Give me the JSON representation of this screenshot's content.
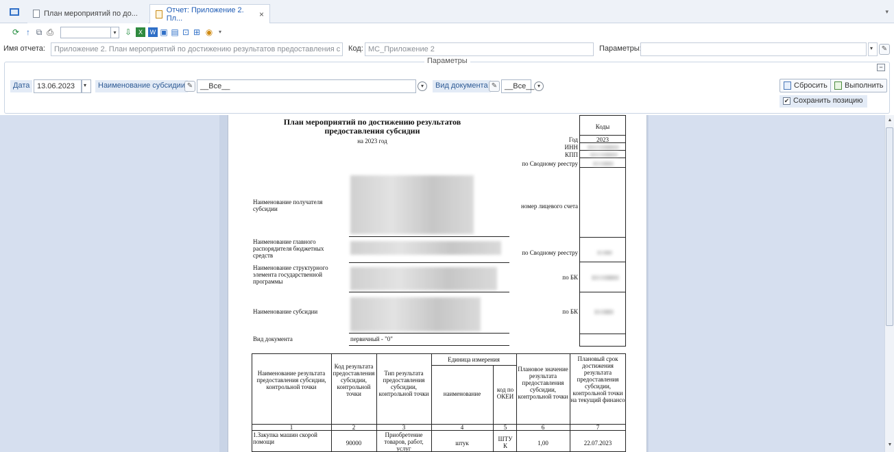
{
  "tabs": [
    {
      "label": "План мероприятий по до..."
    },
    {
      "label": "Отчет: Приложение 2. Пл..."
    }
  ],
  "tab_close": "×",
  "tab_menu_arrow": "▾",
  "name_row": {
    "report_name_label": "Имя отчета:",
    "report_name_value": "Приложение 2. План мероприятий по достижению результатов предоставления с",
    "code_label": "Код:",
    "code_value": "МС_Приложение 2",
    "params_label": "Параметры:",
    "params_value": ""
  },
  "params_panel": {
    "title": "Параметры",
    "date_label": "Дата",
    "date_value": "13.06.2023",
    "subsidy_label": "Наименование субсидии",
    "subsidy_value": "__Все__",
    "doc_type_label": "Вид документа",
    "doc_type_value": "__Все__",
    "reset_button": "Сбросить",
    "run_button": "Выполнить",
    "save_position": "Сохранить позицию",
    "save_position_checked": "✔"
  },
  "document": {
    "title_line1": "План мероприятий по достижению результатов",
    "title_line2": "предоставления субсидии",
    "year_line": "на 2023 год",
    "codes_header": "Коды",
    "year_label": "Год",
    "year_value": "2023",
    "inn_label": "ИНН",
    "kpp_label": "КПП",
    "svodny_label": "по Сводному реестру",
    "recipient_label": "Наименование получателя субсидии",
    "account_label": "номер лицевого счета",
    "grbs_label": "Наименование главного распорядителя бюджетных средств",
    "svodny_label2": "по Сводному реестру",
    "struct_label": "Наименование структурного элемента государственной программы",
    "bk_label": "по БК",
    "subsidy_name_label": "Наименование субсидии",
    "bk_label2": "по БК",
    "doc_type_label": "Вид документа",
    "doc_type_value": "первичный - \"0\""
  },
  "table": {
    "headers": {
      "col1": "Наименование результата предоставления субсидии, контрольной точки",
      "col2": "Код результата предоставления субсидии, контрольной точки",
      "col3": "Тип результата предоставления субсидии, контрольной точки",
      "unit_group": "Единица измерения",
      "col4": "наименование",
      "col5": "код по ОКЕИ",
      "col6": "Плановое значение результата предоставления субсидии, контрольной точки",
      "col7": "Плановый срок достижения результата предоставления субсидии, контрольной точки на текущий финансо"
    },
    "col_numbers": [
      "1",
      "2",
      "3",
      "4",
      "5",
      "6",
      "7"
    ],
    "rows": [
      {
        "c1": "1.Закупка машин скорой помощи",
        "c2": "90000",
        "c3": "Приобретение товаров, работ, услуг",
        "c4": "штук",
        "c5": "ШТУК",
        "c6": "1,00",
        "c7": "22.07.2023"
      }
    ]
  }
}
